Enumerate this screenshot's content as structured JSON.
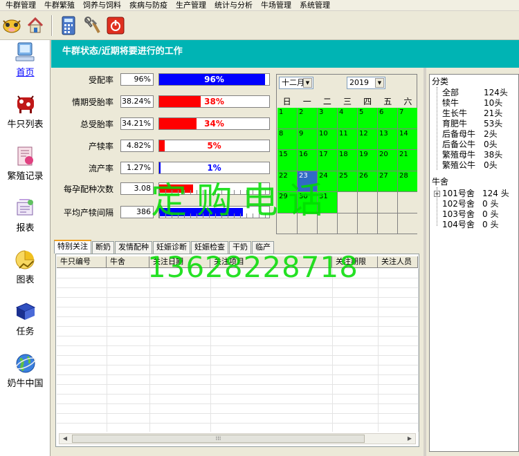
{
  "menu": [
    "牛群管理",
    "牛群繁殖",
    "饲养与饲料",
    "疾病与防疫",
    "生产管理",
    "统计与分析",
    "牛场管理",
    "系统管理"
  ],
  "toolbar": [
    {
      "icon": "cow-icon"
    },
    {
      "icon": "home-icon"
    },
    {
      "icon": "calculator-icon"
    },
    {
      "icon": "tools-icon"
    },
    {
      "icon": "power-icon"
    }
  ],
  "nav": [
    {
      "label": "首页",
      "icon": "computer-icon"
    },
    {
      "label": "牛只列表",
      "icon": "cow-list-icon"
    },
    {
      "label": "繁殖记录",
      "icon": "breeding-record-icon"
    },
    {
      "label": "报表",
      "icon": "report-icon"
    },
    {
      "label": "图表",
      "icon": "chart-icon"
    },
    {
      "label": "任务",
      "icon": "task-book-icon"
    },
    {
      "label": "奶牛中国",
      "icon": "globe-icon"
    }
  ],
  "title": "牛群状态/近期将要进行的工作",
  "stats": [
    {
      "label": "受配率",
      "value": "96%",
      "pct": "96%",
      "level": 0.96,
      "color": "#0000ff",
      "textColor": "#ffffff"
    },
    {
      "label": "情期受胎率",
      "value": "38.24%",
      "pct": "38%",
      "level": 0.38,
      "color": "#ff0000",
      "textColor": "#ff0000"
    },
    {
      "label": "总受胎率",
      "value": "34.21%",
      "pct": "34%",
      "level": 0.34,
      "color": "#ff0000",
      "textColor": "#ff0000"
    },
    {
      "label": "产犊率",
      "value": "4.82%",
      "pct": "5%",
      "level": 0.05,
      "color": "#ff0000",
      "textColor": "#ff0000"
    },
    {
      "label": "流产率",
      "value": "1.27%",
      "pct": "1%",
      "level": 0.01,
      "color": "#0000ff",
      "textColor": "#0000ff"
    },
    {
      "label": "每孕配种次数",
      "value": "3.08",
      "pct": "",
      "level": 0.31,
      "color": "#ff0000",
      "textColor": "#ff0000"
    },
    {
      "label": "平均产犊间隔",
      "value": "386",
      "pct": "",
      "level": 0.76,
      "color": "#0000ff",
      "textColor": "#0000ff"
    }
  ],
  "calendar": {
    "month": "十二月",
    "year": "2019",
    "weekdays": [
      "日",
      "一",
      "二",
      "三",
      "四",
      "五",
      "六"
    ],
    "days": [
      "1",
      "2",
      "3",
      "4",
      "5",
      "6",
      "7",
      "8",
      "9",
      "10",
      "11",
      "12",
      "13",
      "14",
      "15",
      "16",
      "17",
      "18",
      "19",
      "20",
      "21",
      "22",
      "23",
      "24",
      "25",
      "26",
      "27",
      "28",
      "29",
      "30",
      "31"
    ],
    "today": "23",
    "highlight_color": "#00ff00"
  },
  "tabs": [
    "特别关注",
    "断奶",
    "发情配种",
    "妊娠诊断",
    "妊娠检查",
    "干奶",
    "临产"
  ],
  "table": {
    "columns": [
      "牛只编号",
      "牛舍",
      "关注日期",
      "关注项目",
      "关注期限",
      "关注人员"
    ]
  },
  "tree": {
    "category_root": "分类",
    "categories": [
      {
        "name": "全部",
        "count": "124头"
      },
      {
        "name": "犊牛",
        "count": "10头"
      },
      {
        "name": "生长牛",
        "count": "21头"
      },
      {
        "name": "育肥牛",
        "count": "53头"
      },
      {
        "name": "后备母牛",
        "count": "2头"
      },
      {
        "name": "后备公牛",
        "count": "0头"
      },
      {
        "name": "繁殖母牛",
        "count": "38头"
      },
      {
        "name": "繁殖公牛",
        "count": "0头"
      }
    ],
    "barn_root": "牛舍",
    "barns": [
      {
        "name": "101号舍",
        "count": "124 头",
        "expandable": true
      },
      {
        "name": "102号舍",
        "count": "0 头",
        "expandable": false
      },
      {
        "name": "103号舍",
        "count": "0 头",
        "expandable": false
      },
      {
        "name": "104号舍",
        "count": "0 头",
        "expandable": false
      }
    ]
  },
  "watermark": {
    "line1": "定购电话",
    "line2": "13628228718"
  }
}
